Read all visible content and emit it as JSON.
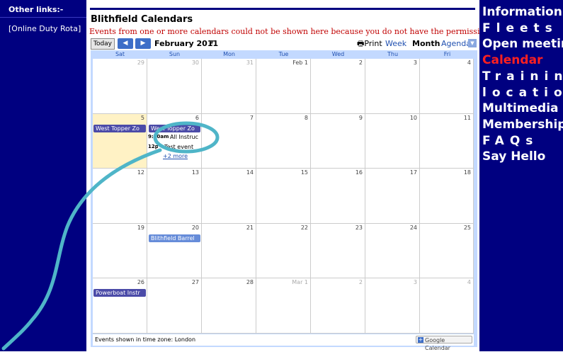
{
  "left_sidebar": {
    "title": "Other links:-",
    "links": [
      "[Online Duty Rota]"
    ]
  },
  "right_nav": {
    "items": [
      "Information",
      "Fleets",
      "Open meeting",
      "Calendar",
      "Training",
      "location",
      "Multimedia",
      "Membership",
      "FAQs",
      "Say Hello"
    ],
    "active": "Calendar",
    "active_color": "#ff2020",
    "background": "#000080"
  },
  "calendar": {
    "title": "Blithfield Calendars",
    "warning": "Events from one or more calendars could not be shown here because you do not have the permission to view them.",
    "toolbar": {
      "today": "Today",
      "prev_icon": "chevron-left-icon",
      "next_icon": "chevron-right-icon",
      "month_label": "February 2011",
      "print": "Print",
      "views": [
        "Week",
        "Month",
        "Agenda"
      ],
      "selected_view": "Month"
    },
    "weekdays": [
      "Sat",
      "Sun",
      "Mon",
      "Tue",
      "Wed",
      "Thu",
      "Fri"
    ],
    "weeks": [
      [
        "29",
        "30",
        "31",
        "Feb 1",
        "2",
        "3",
        "4"
      ],
      [
        "5",
        "6",
        "7",
        "8",
        "9",
        "10",
        "11"
      ],
      [
        "12",
        "13",
        "14",
        "15",
        "16",
        "17",
        "18"
      ],
      [
        "19",
        "20",
        "21",
        "22",
        "23",
        "24",
        "25"
      ],
      [
        "26",
        "27",
        "28",
        "Mar 1",
        "2",
        "3",
        "4"
      ]
    ],
    "events": {
      "sat5": "West Topper Zo",
      "sun6_bar": "West Topper Zo",
      "sun6_time1": "9:30am",
      "sun6_text1": "All Instruc",
      "sun6_time2": "12p",
      "sun6_text2": "Test event",
      "sun6_more": "+2 more",
      "sun20": "Blithfield Barrel",
      "sat26": "Powerboat Instr"
    },
    "footer": {
      "timezone": "Events shown in time zone: London",
      "google_calendar": "Google Calendar"
    },
    "colors": {
      "event": "#4b4ba8",
      "event_light": "#668cd9",
      "today": "#fff2c5",
      "annotation": "#4fb5c8"
    }
  }
}
